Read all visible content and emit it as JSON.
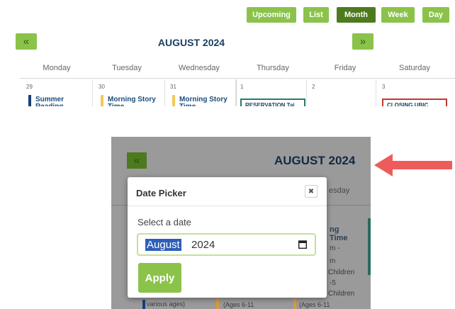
{
  "view_buttons": [
    "Upcoming",
    "List",
    "Month",
    "Week",
    "Day"
  ],
  "nav": {
    "prev": "«",
    "next": "»"
  },
  "calendar": {
    "title": "AUGUST 2024",
    "day_headers": [
      "Monday",
      "Tuesday",
      "Wednesday",
      "Thursday",
      "Friday",
      "Saturday"
    ],
    "dates": [
      "29",
      "30",
      "31",
      "1",
      "2",
      "3"
    ],
    "events": {
      "mon": "Summer Reading Challenge",
      "tue": "Morning Story Time",
      "wed": "Morning Story Time",
      "thu": "RESERVATION Tai Chi Group",
      "sat": "CLOSING UBIC"
    },
    "colors": {
      "accent": "#8bc34a",
      "accent_dark": "#4e7a1e",
      "title": "#1a3f66",
      "navy_bar": "#1a3f7a",
      "yellow_bar": "#f5c75a",
      "teal_border": "#2a7a6e",
      "red_border": "#c0392b",
      "arrow": "#ee5b5b"
    }
  },
  "zoom": {
    "title": "AUGUST 2024",
    "prev": "«",
    "bg_day": "esday",
    "bg_events": [
      "ng",
      "Time",
      "m -",
      "m",
      "Children",
      "-5",
      "Children",
      "(Ages 6-11",
      "(Ages 6-11",
      "various ages)"
    ],
    "modal": {
      "title": "Date Picker",
      "close": "✖",
      "label": "Select a date",
      "month": "August",
      "year": "2024",
      "calendar_icon": "calendar-icon",
      "apply": "Apply"
    }
  }
}
